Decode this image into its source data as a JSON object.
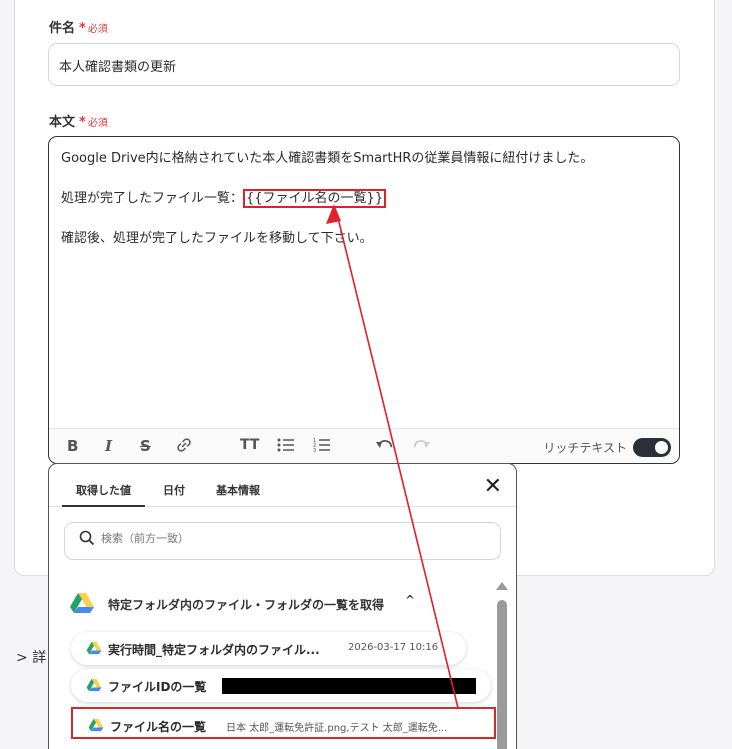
{
  "subject": {
    "label": "件名",
    "required_mark": "*",
    "required_text": "必須",
    "value": "本人確認書類の更新"
  },
  "body": {
    "label": "本文",
    "required_mark": "*",
    "required_text": "必須",
    "line1": "Google Drive内に格納されていた本人確認書類をSmartHRの従業員情報に紐付けました。",
    "line2_prefix": "処理が完了したファイル一覧：",
    "line2_placeholder": "{{ファイル名の一覧}}",
    "line3": "確認後、処理が完了したファイルを移動して下さい。"
  },
  "toolbar": {
    "rich_text_label": "リッチテキスト",
    "rich_text_enabled": true,
    "icons": [
      "bold-icon",
      "italic-icon",
      "strikethrough-icon",
      "link-icon",
      "text-size-icon",
      "bullet-list-icon",
      "numbered-list-icon",
      "undo-icon",
      "redo-icon"
    ]
  },
  "details_label": "詳",
  "popup": {
    "tabs": [
      "取得した値",
      "日付",
      "基本情報"
    ],
    "active_tab": 0,
    "search_placeholder": "検索（前方一致）",
    "group_title": "特定フォルダ内のファイル・フォルダの一覧を取得",
    "items": [
      {
        "name": "実行時間_特定フォルダ内のファイル...",
        "value": "2026-03-17 10:16"
      },
      {
        "name": "ファイルIDの一覧",
        "value": ""
      },
      {
        "name": "ファイル名の一覧",
        "value": "日本 太郎_運転免許証.png,テスト 太郎_運転免..."
      }
    ]
  },
  "colors": {
    "accent_red": "#e0202a",
    "toggle_dark": "#2b2f38",
    "drive_green": "#1fa463",
    "drive_yellow": "#ffd04b",
    "drive_blue": "#4688f4"
  }
}
